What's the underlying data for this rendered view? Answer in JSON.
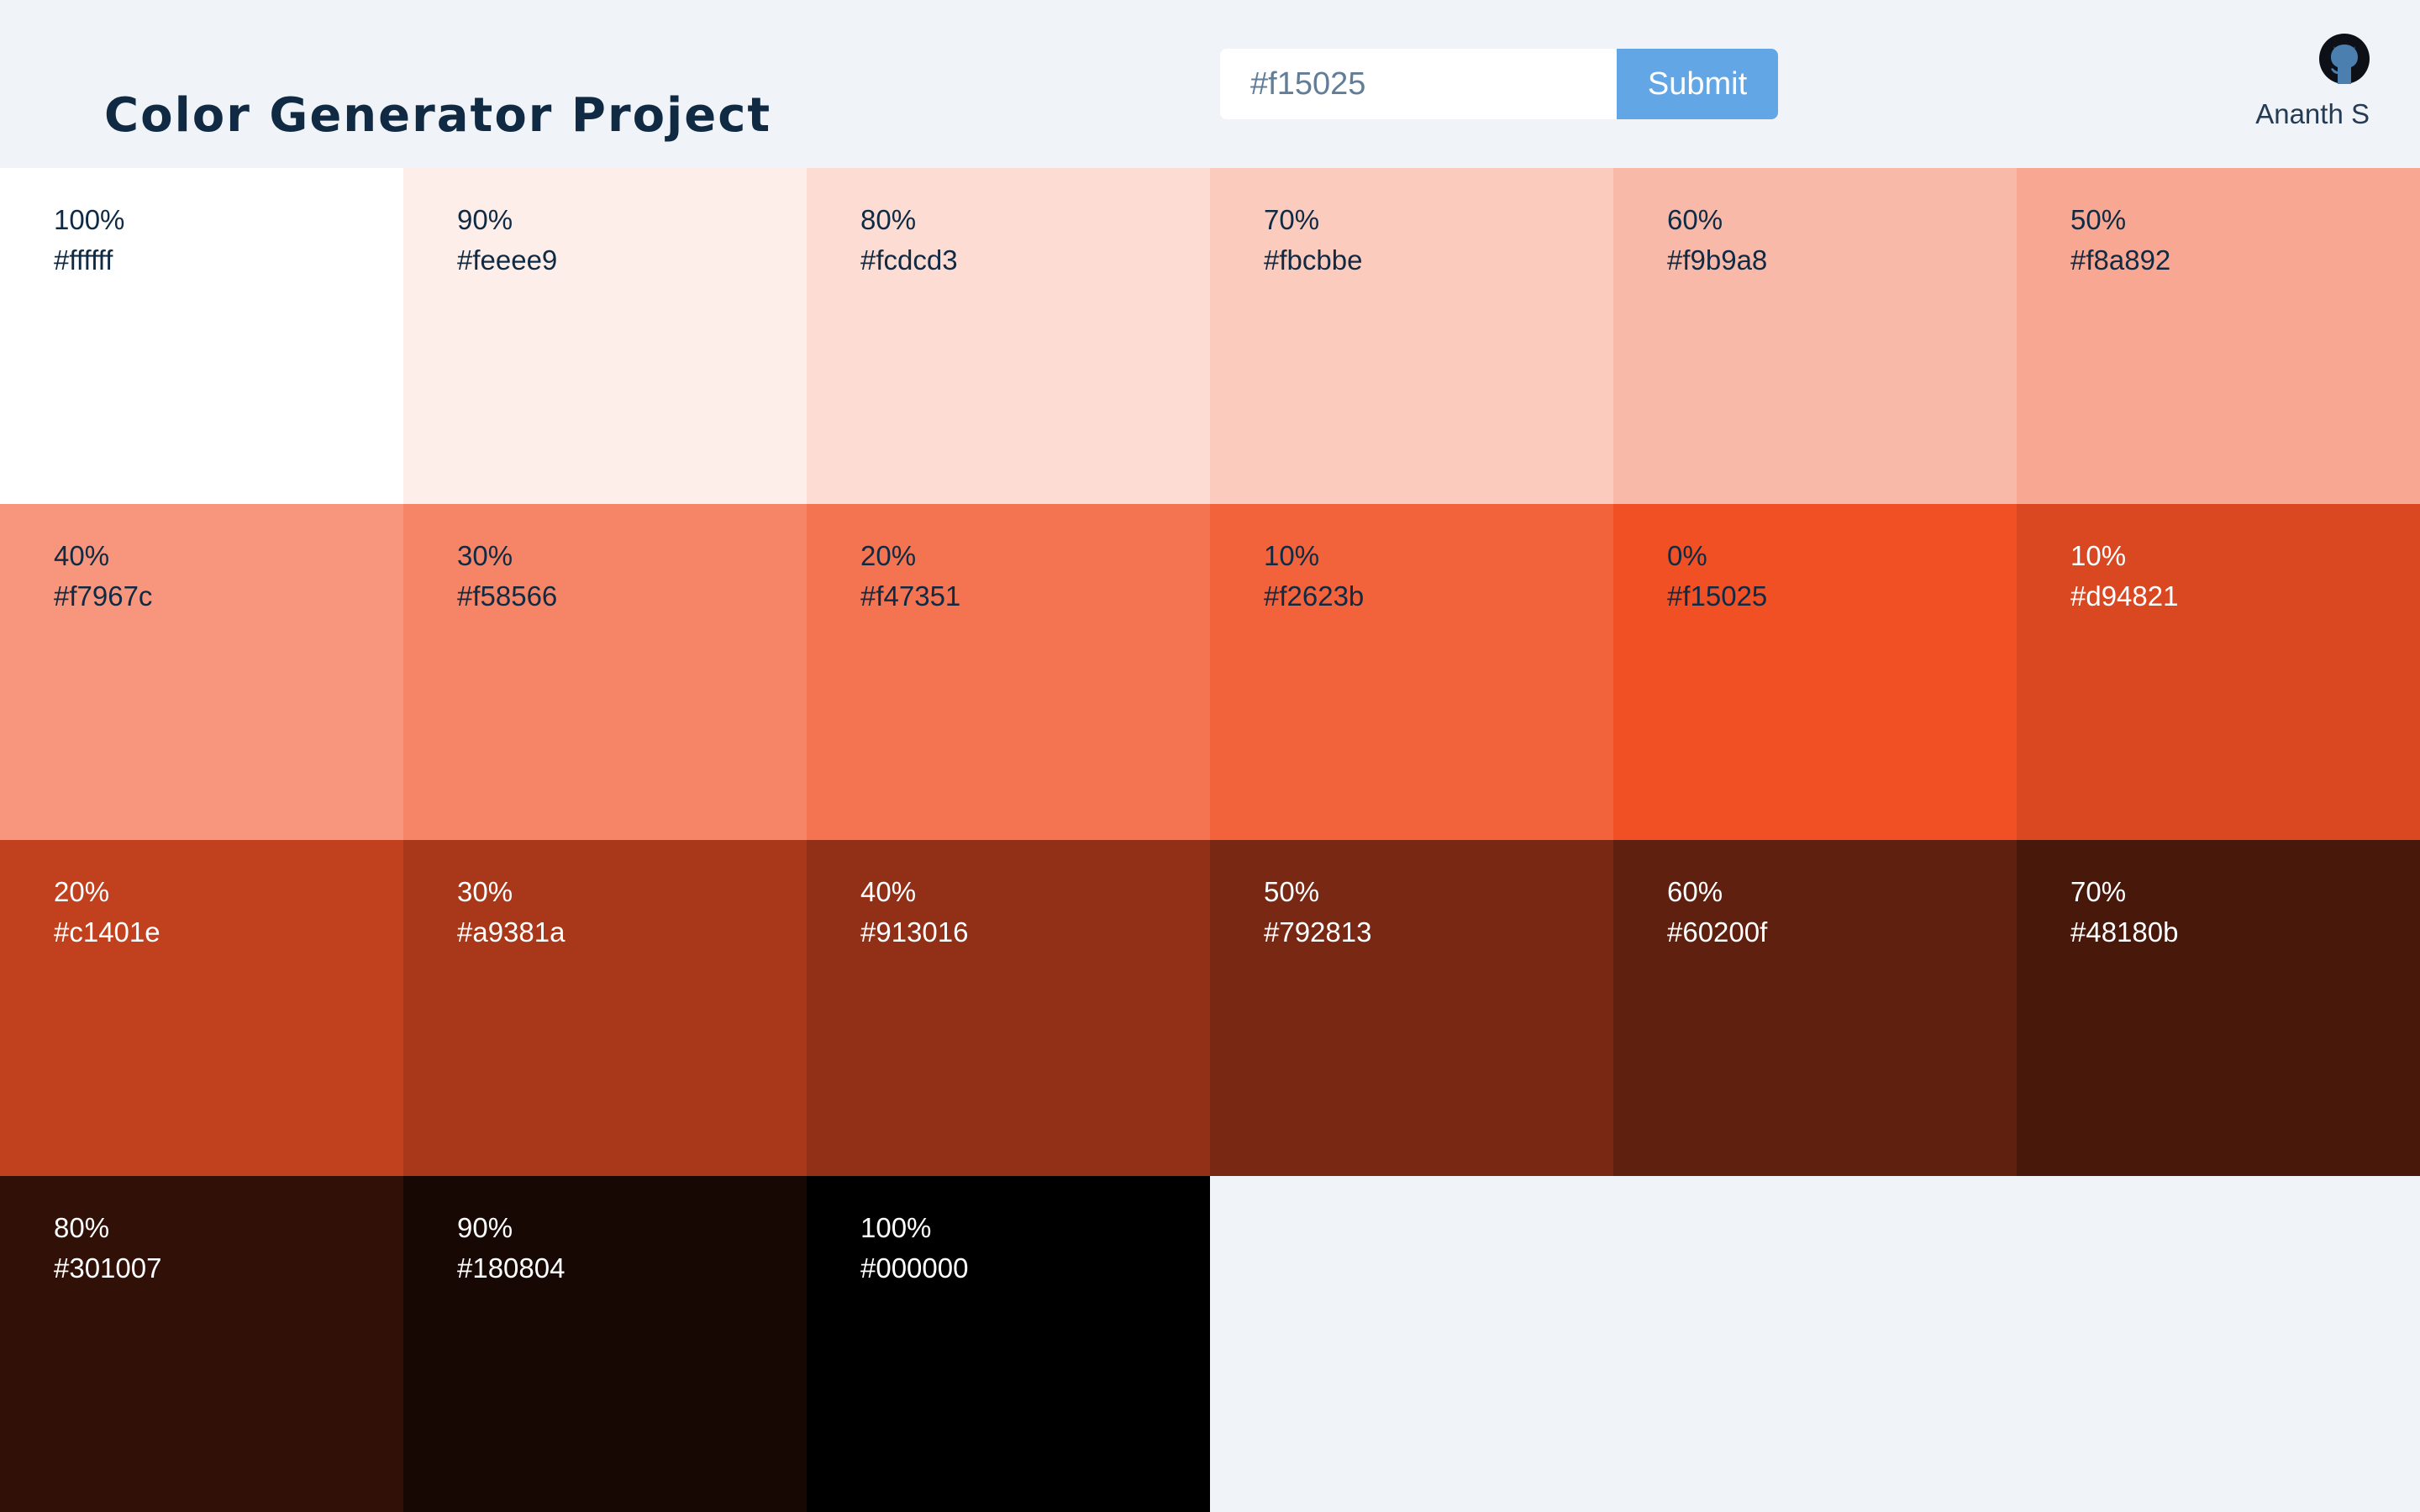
{
  "header": {
    "title": "Color Generator Project",
    "input_placeholder": "#f15025",
    "submit_label": "Submit",
    "author": "Ananth S",
    "github_icon": "github-icon"
  },
  "colors": {
    "accent": "#63a6e6",
    "title": "#102a43",
    "page_background": "#f0f4f8"
  },
  "swatches": [
    {
      "percent": "100%",
      "hex": "#ffffff",
      "text": "light"
    },
    {
      "percent": "90%",
      "hex": "#feeee9",
      "text": "light"
    },
    {
      "percent": "80%",
      "hex": "#fcdcd3",
      "text": "light"
    },
    {
      "percent": "70%",
      "hex": "#fbcbbe",
      "text": "light"
    },
    {
      "percent": "60%",
      "hex": "#f9b9a8",
      "text": "light"
    },
    {
      "percent": "50%",
      "hex": "#f8a892",
      "text": "light"
    },
    {
      "percent": "40%",
      "hex": "#f7967c",
      "text": "light"
    },
    {
      "percent": "30%",
      "hex": "#f58566",
      "text": "light"
    },
    {
      "percent": "20%",
      "hex": "#f47351",
      "text": "light"
    },
    {
      "percent": "10%",
      "hex": "#f2623b",
      "text": "light"
    },
    {
      "percent": "0%",
      "hex": "#f15025",
      "text": "light"
    },
    {
      "percent": "10%",
      "hex": "#d94821",
      "text": "dark"
    },
    {
      "percent": "20%",
      "hex": "#c1401e",
      "text": "dark"
    },
    {
      "percent": "30%",
      "hex": "#a9381a",
      "text": "dark"
    },
    {
      "percent": "40%",
      "hex": "#913016",
      "text": "dark"
    },
    {
      "percent": "50%",
      "hex": "#792813",
      "text": "dark"
    },
    {
      "percent": "60%",
      "hex": "#60200f",
      "text": "dark"
    },
    {
      "percent": "70%",
      "hex": "#48180b",
      "text": "dark"
    },
    {
      "percent": "80%",
      "hex": "#301007",
      "text": "dark"
    },
    {
      "percent": "90%",
      "hex": "#180804",
      "text": "dark"
    },
    {
      "percent": "100%",
      "hex": "#000000",
      "text": "dark"
    }
  ]
}
